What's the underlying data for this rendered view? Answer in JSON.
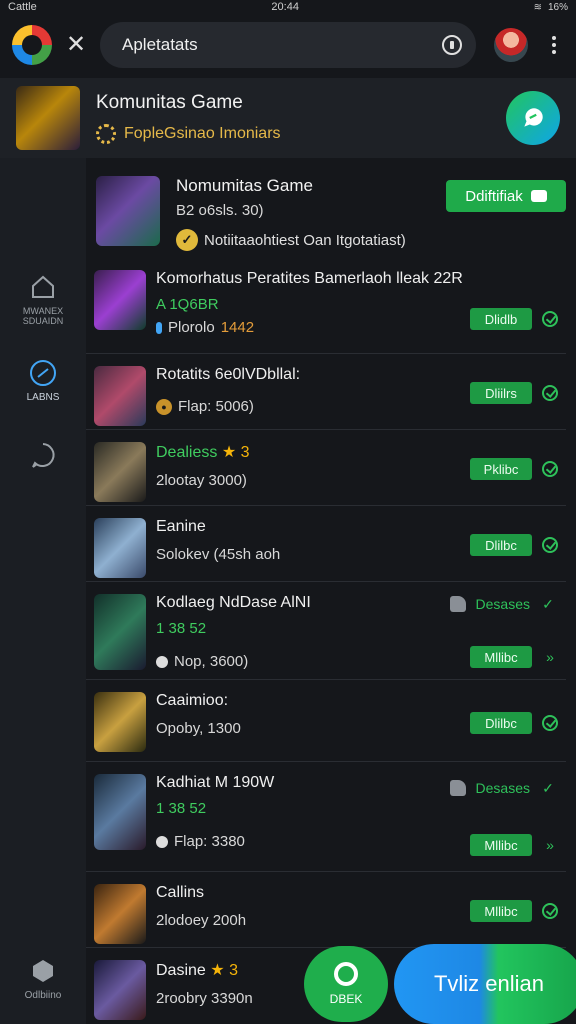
{
  "status_bar": {
    "left": "Cattle",
    "time": "20:44",
    "battery": "16%"
  },
  "search": {
    "query": "Apletatats"
  },
  "header": {
    "title": "Komunitas Game",
    "subtitle": "FopleGsinao Imoniars"
  },
  "sidebar": {
    "items": [
      {
        "label": "MWANEX\nSDUAIDN"
      },
      {
        "label": "LABNS"
      },
      {
        "label": ""
      },
      {
        "label": "Odlbiino"
      }
    ]
  },
  "featured": {
    "title": "Nomumitas Game",
    "meta": "B2 o6sls. 30)",
    "sub": "Notiitaaohtiest Oan Itgotatiast)",
    "button": "Ddiftifiak"
  },
  "rows": [
    {
      "title": "Komorhatus Peratites Bamerlaoh lleak 22R",
      "line2": "A 1Q6BR",
      "line3a": "Plorolo",
      "line3b": "1442",
      "button": "Dlidlb"
    },
    {
      "title": "Rotatits 6e0lVDbllal:",
      "line3a": "Flap: 5006)",
      "button": "Dliilrs"
    },
    {
      "title": "Dealiess",
      "title_suffix": "3",
      "line3a": "2lootay 3000)",
      "button": "Pklibc"
    },
    {
      "title": "Eanine",
      "line3a": "Solokev (45sh aoh",
      "button": "Dlilbc"
    },
    {
      "title": "Kodlaeg NdDase AlNI",
      "line2": "1 38 52",
      "line3a": "Nop, 3600)",
      "extra": "Desases",
      "button": "Mllibc"
    },
    {
      "title": "Caaimioo:",
      "line3a": "Opoby, 1300",
      "button": "Dlilbc"
    },
    {
      "title": "Kadhiat M 190W",
      "line2": "1 38 52",
      "line3a": "Flap: 3380",
      "extra": "Desases",
      "button": "Mllibc"
    },
    {
      "title": "Callins",
      "line3a": "2lodoey 200h",
      "button": "Mllibc"
    },
    {
      "title": "Dasine",
      "title_suffix": "3",
      "line3a": "2roobry 3390n"
    }
  ],
  "bottom": {
    "deek": "DBEK",
    "cta": "Tvliz enlian"
  },
  "colors": {
    "accent_green": "#1faa4a",
    "bg": "#15171b",
    "gold": "#e6b949",
    "blue": "#1e88e5"
  }
}
